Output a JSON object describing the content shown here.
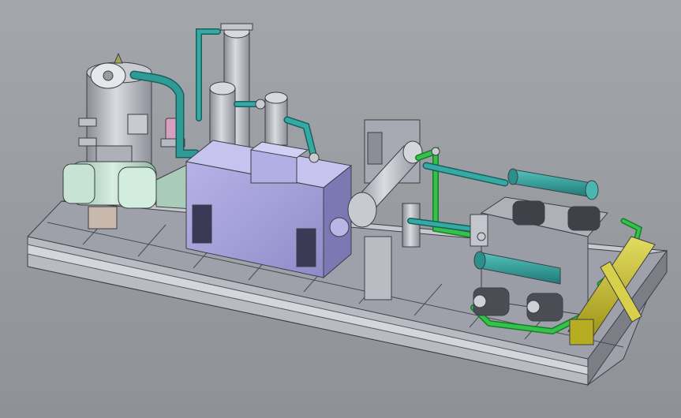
{
  "viewport": {
    "background_top": "#a3a7ac",
    "background_bottom": "#8e9297"
  },
  "colors": {
    "skid_frame": "#b9bcc3",
    "skid_dark": "#6e7178",
    "motor_body": "#a7a3da",
    "motor_dark": "#7c78b4",
    "pipe_teal": "#2f9a96",
    "pipe_green": "#33c24a",
    "steel": "#b7bac2",
    "coupling_green": "#b5d7c4",
    "heat_exchanger_teal": "#3aa7a0",
    "accent_yellow": "#cbbd2a",
    "filter_pink": "#d99fc0"
  },
  "model": {
    "parts": [
      "skid-base",
      "vertical-separator",
      "inlet-scrubbers",
      "coupling-housing",
      "main-motor",
      "compressor-frame",
      "discharge-cylinder",
      "lube-oil-console",
      "oil-cooler",
      "oil-pumps",
      "instrument-panel"
    ]
  }
}
